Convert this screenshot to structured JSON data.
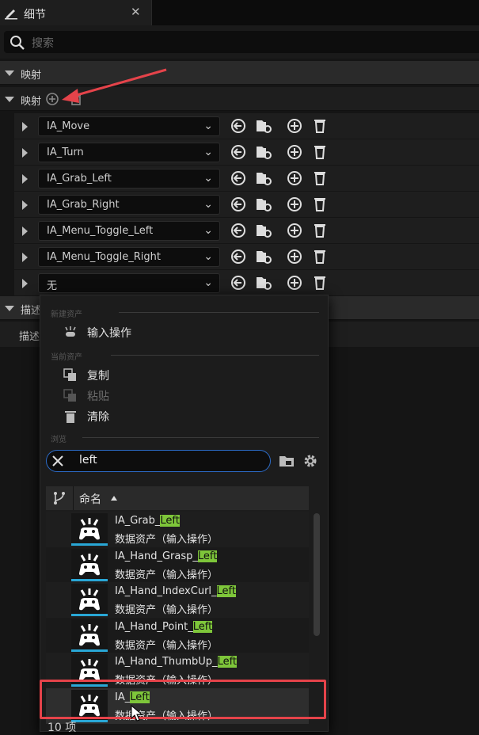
{
  "tab": {
    "title": "细节",
    "close": "✕"
  },
  "search": {
    "placeholder": "搜索"
  },
  "sections": {
    "mapping1": "映射",
    "mapping2": "映射",
    "desc": "描述",
    "desc_row": "描述"
  },
  "rows": [
    {
      "label": "IA_Move"
    },
    {
      "label": "IA_Turn"
    },
    {
      "label": "IA_Grab_Left"
    },
    {
      "label": "IA_Grab_Right"
    },
    {
      "label": "IA_Menu_Toggle_Left"
    },
    {
      "label": "IA_Menu_Toggle_Right"
    },
    {
      "label": "无"
    }
  ],
  "popup": {
    "hdr_new": "新建资产",
    "new_input_action": "输入操作",
    "hdr_current": "当前资产",
    "copy": "复制",
    "paste": "粘贴",
    "clear": "清除",
    "hdr_browse": "浏览",
    "filter_value": "left",
    "col_name": "命名",
    "count": "10 项"
  },
  "assets": [
    {
      "prefix": "IA_Grab_",
      "match": "Left",
      "type": "数据资产（输入操作）"
    },
    {
      "prefix": "IA_Hand_Grasp_",
      "match": "Left",
      "type": "数据资产（输入操作）"
    },
    {
      "prefix": "IA_Hand_IndexCurl_",
      "match": "Left",
      "type": "数据资产（输入操作）"
    },
    {
      "prefix": "IA_Hand_Point_",
      "match": "Left",
      "type": "数据资产（输入操作）"
    },
    {
      "prefix": "IA_Hand_ThumbUp_",
      "match": "Left",
      "type": "数据资产（输入操作）"
    },
    {
      "prefix": "IA_",
      "match": "Left",
      "type": "数据资产（输入操作）"
    }
  ],
  "colors": {
    "highlight": "#7ec63a",
    "annotation": "#e5434a",
    "focus": "#2c6cc9"
  }
}
